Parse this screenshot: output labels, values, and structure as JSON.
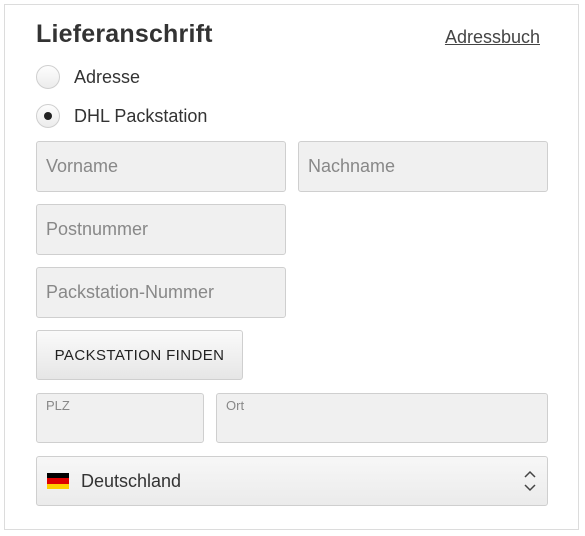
{
  "header": {
    "title": "Lieferanschrift",
    "address_book_link": "Adressbuch"
  },
  "radios": [
    {
      "label": "Adresse",
      "checked": false
    },
    {
      "label": "DHL Packstation",
      "checked": true
    }
  ],
  "fields": {
    "firstname": {
      "placeholder": "Vorname",
      "value": ""
    },
    "lastname": {
      "placeholder": "Nachname",
      "value": ""
    },
    "postnumber": {
      "placeholder": "Postnummer",
      "value": ""
    },
    "packstation_number": {
      "placeholder": "Packstation-Nummer",
      "value": ""
    },
    "zip": {
      "label": "PLZ",
      "value": ""
    },
    "city": {
      "label": "Ort",
      "value": ""
    }
  },
  "find_button": {
    "label": "PACKSTATION FINDEN"
  },
  "country_select": {
    "selected": "Deutschland",
    "flag_icon": "germany-flag-icon",
    "flag_colors": [
      "#000000",
      "#dd0000",
      "#ffce00"
    ]
  }
}
